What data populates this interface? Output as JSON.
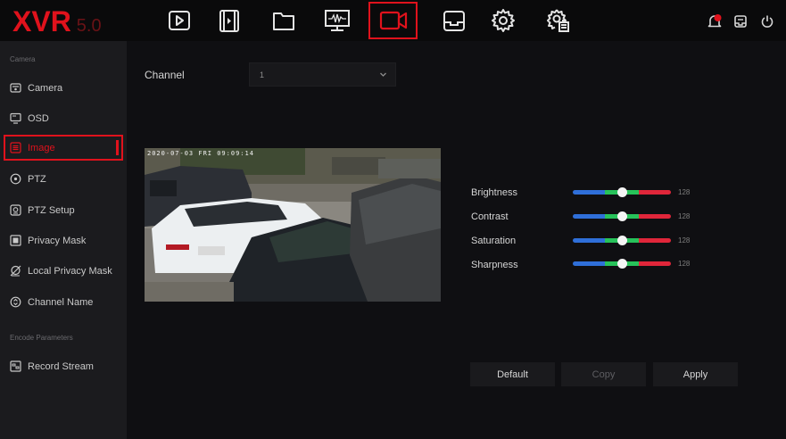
{
  "logo": {
    "main": "XVR",
    "version": "5.0"
  },
  "topnav": [
    {
      "name": "playback-icon"
    },
    {
      "name": "video-file-icon"
    },
    {
      "name": "folder-icon"
    },
    {
      "name": "monitor-icon"
    },
    {
      "name": "camera-icon",
      "active": true
    },
    {
      "name": "storage-icon"
    },
    {
      "name": "gear-icon"
    },
    {
      "name": "system-settings-icon"
    }
  ],
  "topright": [
    {
      "name": "alarm-bell-icon"
    },
    {
      "name": "backup-icon"
    },
    {
      "name": "power-icon"
    }
  ],
  "sidebar": {
    "section_camera": "Camera",
    "section_encode": "Encode Parameters",
    "items": [
      {
        "label": "Camera",
        "icon": "camera-icon"
      },
      {
        "label": "OSD",
        "icon": "osd-icon"
      },
      {
        "label": "Image",
        "icon": "image-icon",
        "active": true
      },
      {
        "label": "PTZ",
        "icon": "ptz-icon"
      },
      {
        "label": "PTZ Setup",
        "icon": "ptz-setup-icon"
      },
      {
        "label": "Privacy Mask",
        "icon": "privacy-mask-icon"
      },
      {
        "label": "Local Privacy Mask",
        "icon": "local-privacy-mask-icon"
      },
      {
        "label": "Channel Name",
        "icon": "channel-name-icon"
      },
      {
        "label": "Record Stream",
        "icon": "record-stream-icon"
      }
    ]
  },
  "main": {
    "channel_label": "Channel",
    "channel_value": "1",
    "osd_time": "2020-07-03 FRI 09:09:14",
    "params": [
      {
        "label": "Brightness",
        "value": "128",
        "level": 0.5
      },
      {
        "label": "Contrast",
        "value": "128",
        "level": 0.5
      },
      {
        "label": "Saturation",
        "value": "128",
        "level": 0.5
      },
      {
        "label": "Sharpness",
        "value": "128",
        "level": 0.5
      }
    ],
    "buttons": {
      "default": "Default",
      "copy": "Copy",
      "apply": "Apply"
    }
  },
  "colors": {
    "accent": "#e0121c",
    "background": "#0f0f12",
    "sidebar": "#1b1b1e"
  }
}
